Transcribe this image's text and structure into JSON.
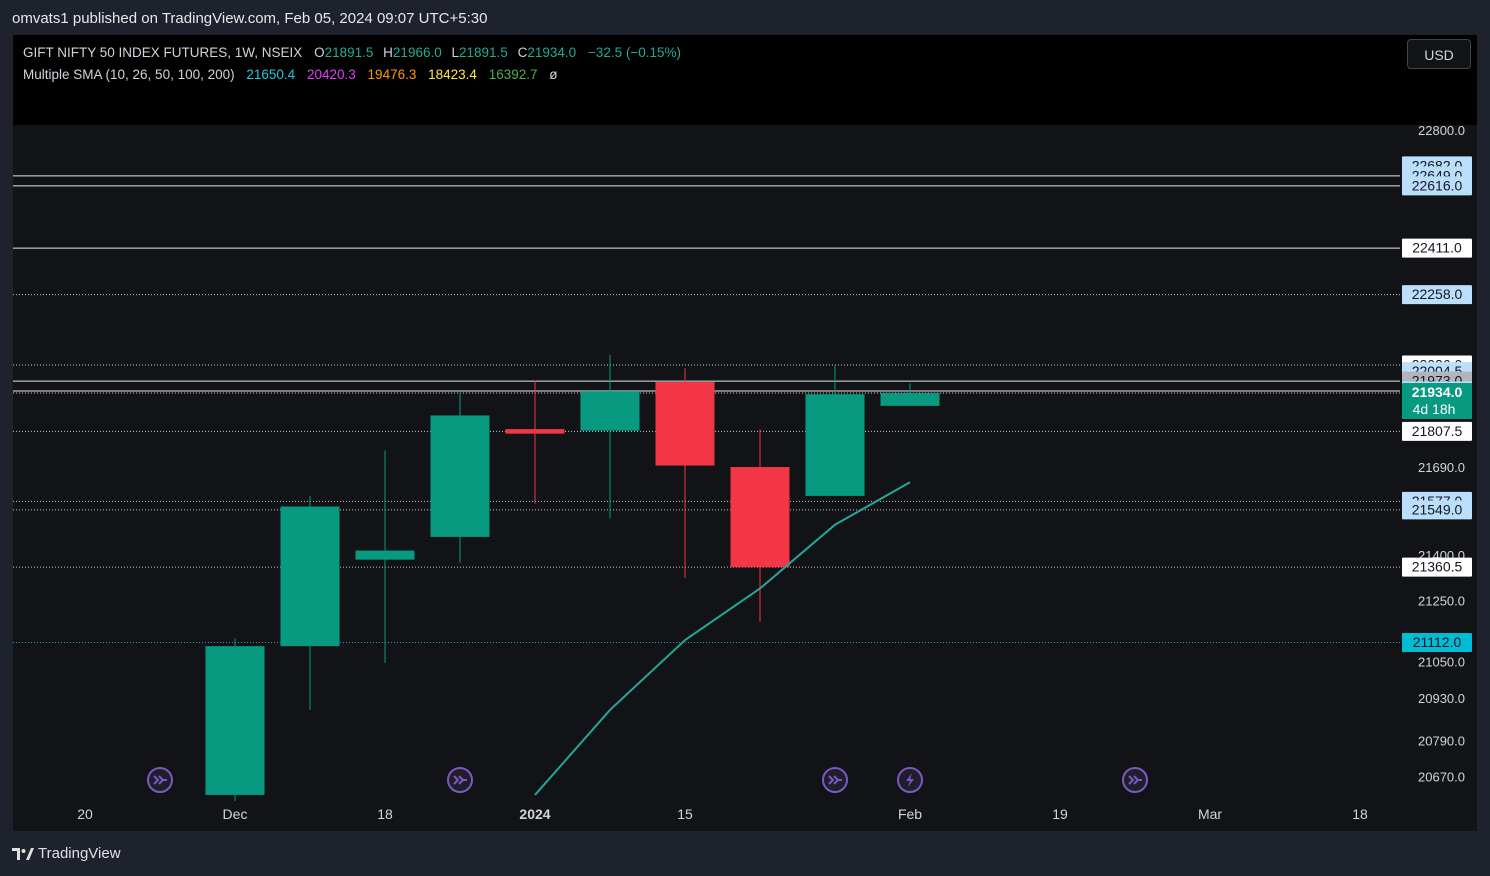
{
  "header": {
    "published": "omvats1 published on TradingView.com, Feb 05, 2024 09:07 UTC+5:30"
  },
  "legend": {
    "symbol": "GIFT NIFTY 50 INDEX FUTURES, 1W, NSEIX",
    "o_label": "O",
    "o": "21891.5",
    "h_label": "H",
    "h": "21966.0",
    "l_label": "L",
    "l": "21891.5",
    "c_label": "C",
    "c": "21934.0",
    "change": "−32.5 (−0.15%)",
    "sma_label": "Multiple SMA (10, 26, 50, 100, 200)",
    "sma_values": [
      "21650.4",
      "20420.3",
      "19476.3",
      "18423.4",
      "16392.7"
    ],
    "sma_colors": [
      "#26c6da",
      "#e040fb",
      "#ff9800",
      "#ffeb3b",
      "#4caf50"
    ],
    "sma_extra": "ø"
  },
  "currency_button": "USD",
  "colors": {
    "up": "#089981",
    "down": "#f23645",
    "sma": "#26a69a",
    "event": "#7e57c2"
  },
  "chart_data": {
    "type": "candlestick",
    "ylim": [
      20590,
      22820
    ],
    "price_axis_ticks": [
      "22800.0",
      "21690.0",
      "21400.0",
      "21250.0",
      "21050.0",
      "20930.0",
      "20790.0",
      "20670.0"
    ],
    "x_ticks": [
      "20",
      "Dec",
      "18",
      "2024",
      "15",
      "Feb",
      "19",
      "Mar",
      "18"
    ],
    "candles": [
      {
        "o": 20610,
        "h": 21125,
        "l": 20590,
        "c": 21100
      },
      {
        "o": 21100,
        "h": 21595,
        "l": 20890,
        "c": 21560
      },
      {
        "o": 21385,
        "h": 21745,
        "l": 21045,
        "c": 21415
      },
      {
        "o": 21460,
        "h": 21935,
        "l": 21375,
        "c": 21860
      },
      {
        "o": 21815,
        "h": 21975,
        "l": 21570,
        "c": 21800
      },
      {
        "o": 21810,
        "h": 22060,
        "l": 21520,
        "c": 21940
      },
      {
        "o": 21970,
        "h": 22015,
        "l": 21325,
        "c": 21695
      },
      {
        "o": 21690,
        "h": 21815,
        "l": 21180,
        "c": 21360
      },
      {
        "o": 21595,
        "h": 22025,
        "l": 21595,
        "c": 21930
      },
      {
        "o": 21891.5,
        "h": 21966,
        "l": 21891.5,
        "c": 21934
      }
    ],
    "sma": {
      "name": "SMA 10",
      "values": [
        null,
        null,
        null,
        null,
        20610,
        20890,
        21120,
        21290,
        21500,
        21640
      ]
    },
    "lines": [
      {
        "value": "22682.0",
        "bg": "#bbdefb",
        "style": "none"
      },
      {
        "value": "22649.0",
        "bg": "#bbdefb",
        "style": "solid"
      },
      {
        "value": "22616.0",
        "bg": "#bbdefb",
        "style": "solid"
      },
      {
        "value": "22411.0",
        "bg": "#ffffff",
        "style": "solid"
      },
      {
        "value": "22258.0",
        "bg": "#bbdefb",
        "style": "dotted"
      },
      {
        "value": "22026.0",
        "bg": "#ffffff",
        "style": "dotted"
      },
      {
        "value": "22004.5",
        "bg": "#bbdefb",
        "style": "none"
      },
      {
        "value": "21973.0",
        "bg": "#b2b5be",
        "style": "solid"
      },
      {
        "value": "21940.5",
        "bg": "#bbdefb",
        "style": "solid"
      },
      {
        "value": "21934.0",
        "bg": "#089981",
        "style": "dotted",
        "sub": "4d 18h"
      },
      {
        "value": "21807.5",
        "bg": "#ffffff",
        "style": "dotted"
      },
      {
        "value": "21577.0",
        "bg": "#bbdefb",
        "style": "dotted"
      },
      {
        "value": "21549.0",
        "bg": "#bbdefb",
        "style": "dotted"
      },
      {
        "value": "21360.5",
        "bg": "#ffffff",
        "style": "dotted"
      },
      {
        "value": "21112.0",
        "bg": "#00bcd4",
        "style": "dotted-teal"
      }
    ],
    "events": [
      {
        "icon": "dividend-icon"
      },
      {
        "icon": "dividend-icon"
      },
      {
        "icon": "dividend-icon"
      },
      {
        "icon": "split-icon"
      },
      {
        "icon": "dividend-icon"
      }
    ]
  },
  "footer": {
    "brand": "TradingView"
  }
}
